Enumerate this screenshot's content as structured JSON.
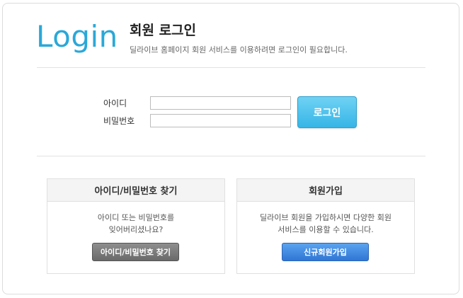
{
  "logo": "Login",
  "header": {
    "title": "회원 로그인",
    "subtitle": "딜라이브 홈페이지 회원 서비스를 이용하려면 로그인이 필요합니다."
  },
  "form": {
    "id_label": "아이디",
    "id_value": "",
    "password_label": "비밀번호",
    "password_value": "",
    "login_button": "로그인"
  },
  "find_panel": {
    "title": "아이디/비밀번호 찾기",
    "desc_line1": "아이디 또는 비밀번호를",
    "desc_line2": "잊어버리셨나요?",
    "button": "아이디/비밀번호 찾기"
  },
  "join_panel": {
    "title": "회원가입",
    "desc_line1": "딜라이브 회원을 가입하시면 다양한 회원",
    "desc_line2": "서비스를 이용할 수 있습니다.",
    "button": "신규회원가입"
  },
  "colors": {
    "accent": "#2aa8d8",
    "login_button": "#36b5e6",
    "join_button": "#2f76d4",
    "find_button": "#6a6a6a"
  }
}
